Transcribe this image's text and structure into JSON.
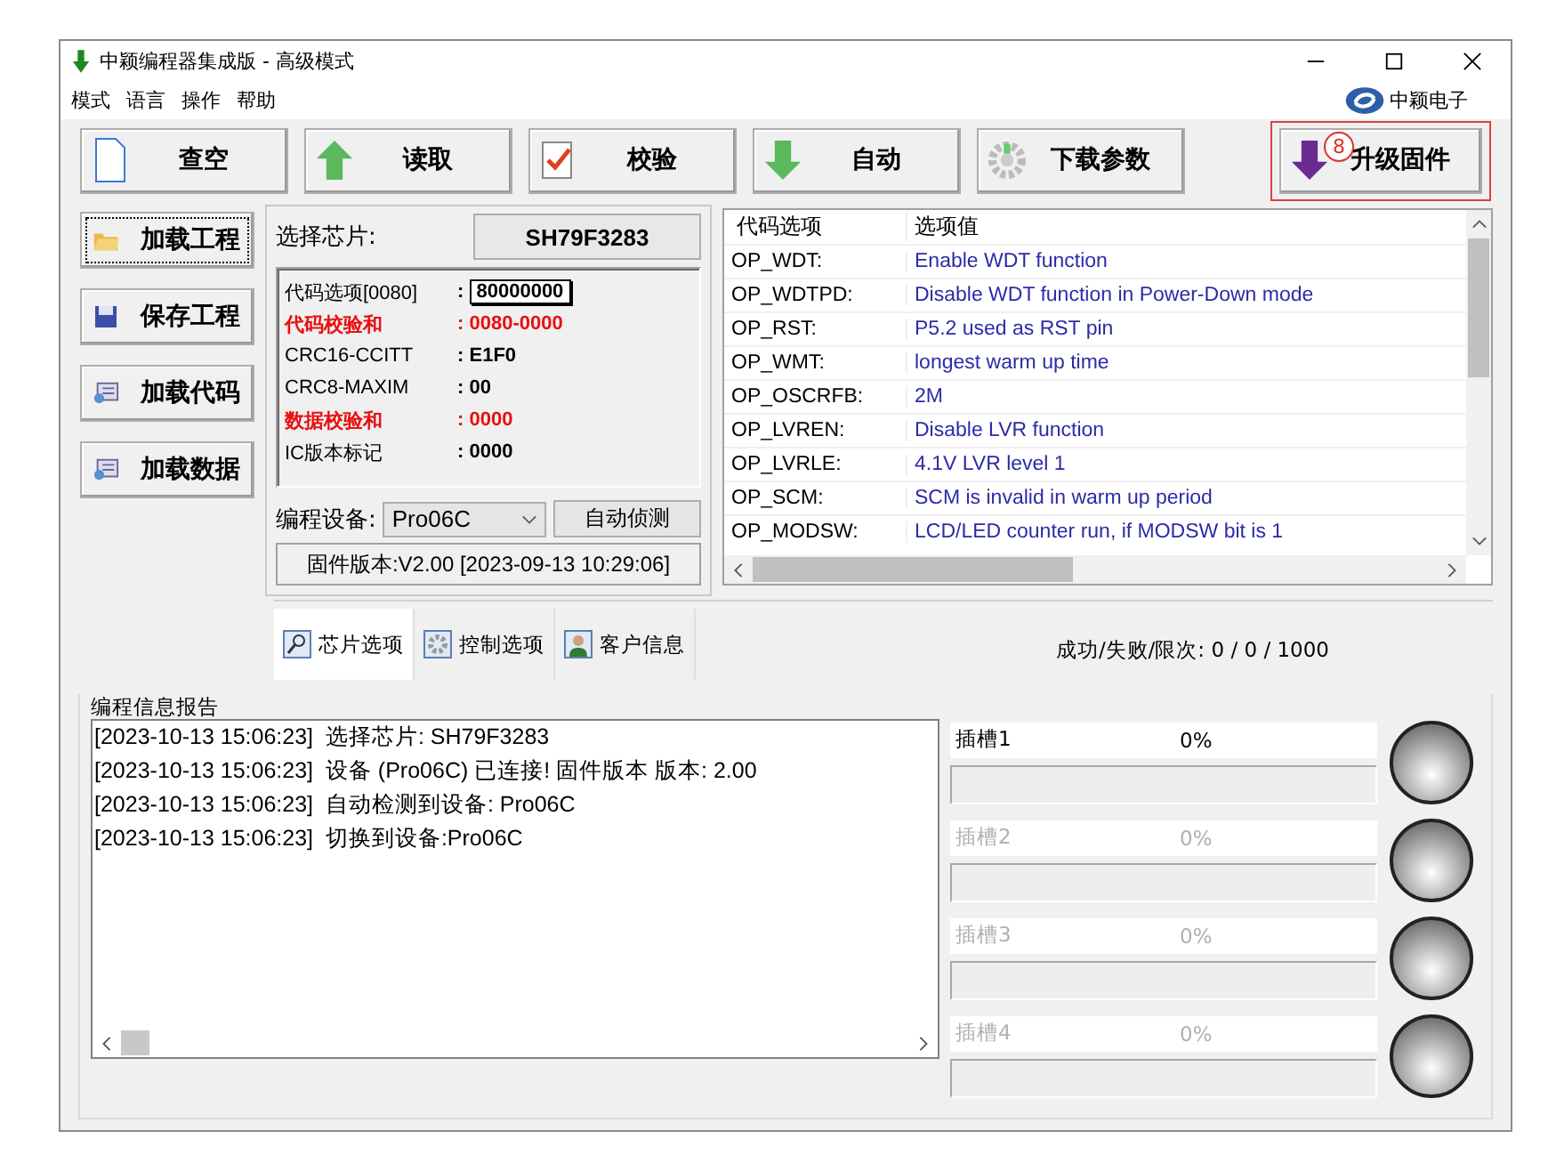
{
  "window": {
    "title": "中颖编程器集成版 - 高级模式"
  },
  "menu": [
    "模式",
    "语言",
    "操作",
    "帮助"
  ],
  "brand": "中颖电子",
  "toolbar": [
    {
      "label": "查空",
      "highlighted": false
    },
    {
      "label": "读取",
      "highlighted": false
    },
    {
      "label": "校验",
      "highlighted": false
    },
    {
      "label": "自动",
      "highlighted": false
    },
    {
      "label": "下载参数",
      "highlighted": false
    },
    {
      "label": "升级固件",
      "highlighted": true,
      "badge": "8"
    }
  ],
  "side_buttons": [
    {
      "label": "加载工程",
      "focused": true
    },
    {
      "label": "保存工程",
      "focused": false
    },
    {
      "label": "加载代码",
      "focused": false
    },
    {
      "label": "加载数据",
      "focused": false
    }
  ],
  "chip": {
    "label": "选择芯片:",
    "value": "SH79F3283"
  },
  "checksums": [
    {
      "name": "代码选项[0080]",
      "sep": ":",
      "value": "80000000",
      "alert": false,
      "boxed": true
    },
    {
      "name": "代码校验和",
      "sep": ":",
      "value": "0080-0000",
      "alert": true,
      "boxed": false
    },
    {
      "name": "CRC16-CCITT",
      "sep": ":",
      "value": "E1F0",
      "alert": false,
      "boxed": false
    },
    {
      "name": "CRC8-MAXIM",
      "sep": ":",
      "value": "00",
      "alert": false,
      "boxed": false
    },
    {
      "name": "数据校验和",
      "sep": ":",
      "value": "0000",
      "alert": true,
      "boxed": false
    },
    {
      "name": "IC版本标记",
      "sep": ":",
      "value": "0000",
      "alert": false,
      "boxed": false
    }
  ],
  "device": {
    "label": "编程设备:",
    "value": "Pro06C",
    "detect_button": "自动侦测",
    "firmware": "固件版本:V2.00 [2023-09-13 10:29:06]"
  },
  "options": {
    "columns": [
      "代码选项",
      "选项值"
    ],
    "rows": [
      [
        "OP_WDT:",
        "Enable WDT function"
      ],
      [
        "OP_WDTPD:",
        "Disable WDT function in Power-Down mode"
      ],
      [
        "OP_RST:",
        "P5.2 used as RST pin"
      ],
      [
        "OP_WMT:",
        "longest warm up time"
      ],
      [
        "OP_OSCRFB:",
        "2M"
      ],
      [
        "OP_LVREN:",
        "Disable LVR function"
      ],
      [
        "OP_LVRLE:",
        "4.1V LVR level 1"
      ],
      [
        "OP_SCM:",
        "SCM is invalid in warm up period"
      ],
      [
        "OP_MODSW:",
        "LCD/LED counter run, if MODSW bit is 1"
      ]
    ]
  },
  "tabs": [
    {
      "label": "芯片选项",
      "selected": true
    },
    {
      "label": "控制选项",
      "selected": false
    },
    {
      "label": "客户信息",
      "selected": false
    }
  ],
  "counter": "成功/失败/限次: 0 / 0 / 1000",
  "report": {
    "title": "编程信息报告",
    "lines": [
      "[2023-10-13 15:06:23]  选择芯片: SH79F3283",
      "[2023-10-13 15:06:23]  设备 (Pro06C) 已连接! 固件版本 版本: 2.00",
      "[2023-10-13 15:06:23]  自动检测到设备: Pro06C",
      "[2023-10-13 15:06:23]  切换到设备:Pro06C"
    ]
  },
  "slots": [
    {
      "name": "插槽1",
      "percent": "0%",
      "enabled": true,
      "level": 0
    },
    {
      "name": "插槽2",
      "percent": "0%",
      "enabled": false,
      "level": 0
    },
    {
      "name": "插槽3",
      "percent": "0%",
      "enabled": false,
      "level": 0
    },
    {
      "name": "插槽4",
      "percent": "0%",
      "enabled": false,
      "level": 0
    }
  ]
}
